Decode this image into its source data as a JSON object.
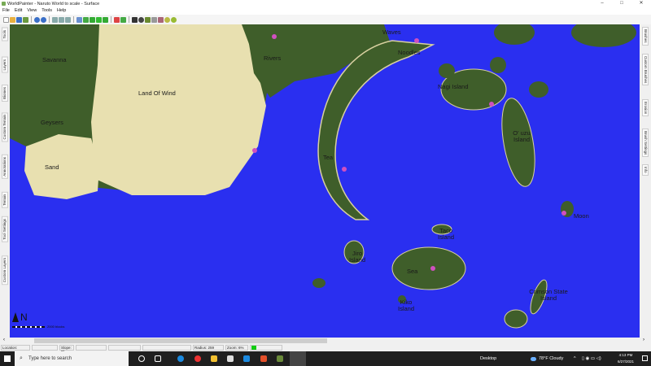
{
  "window": {
    "title": "WorldPainter - Naruto World to scale - Surface",
    "minimize": "–",
    "maximize": "□",
    "close": "✕"
  },
  "menu": [
    "File",
    "Edit",
    "View",
    "Tools",
    "Help"
  ],
  "left_tabs": [
    "Tools",
    "Layers",
    "Biomes",
    "Custom Terrain",
    "Annotations",
    "Terrain",
    "Tool Settings",
    "Custom Layers"
  ],
  "right_tabs": [
    "Brushes",
    "Custom Brushes",
    "Erosion",
    "Brush Settings",
    "Info"
  ],
  "map": {
    "labels": [
      "Savanna",
      "Land Of Wind",
      "Geysers",
      "Sand",
      "Rivers",
      "Waves",
      "Noodles",
      "Nagi Island",
      "O' uzu Island",
      "Tea",
      "Moon",
      "Taco Island",
      "Jiro Island",
      "Sea",
      "Kiko Island",
      "Crimson State Island"
    ],
    "scale_label": "2000 blocks",
    "compass": "N",
    "colors": {
      "water": "#2a2ff0",
      "grass": "#3f5e2a",
      "desert": "#e8e0b0",
      "beach": "#d8d0a0"
    }
  },
  "status": {
    "location": "Location:",
    "slope": "Slope: 0°",
    "radius": "Radius: 259",
    "zoom": "Zoom: 6%"
  },
  "taskbar": {
    "search_placeholder": "Type here to search",
    "desktop": "Desktop",
    "weather": "78°F  Cloudy",
    "time": "4:13 PM",
    "date": "6/27/2021"
  }
}
